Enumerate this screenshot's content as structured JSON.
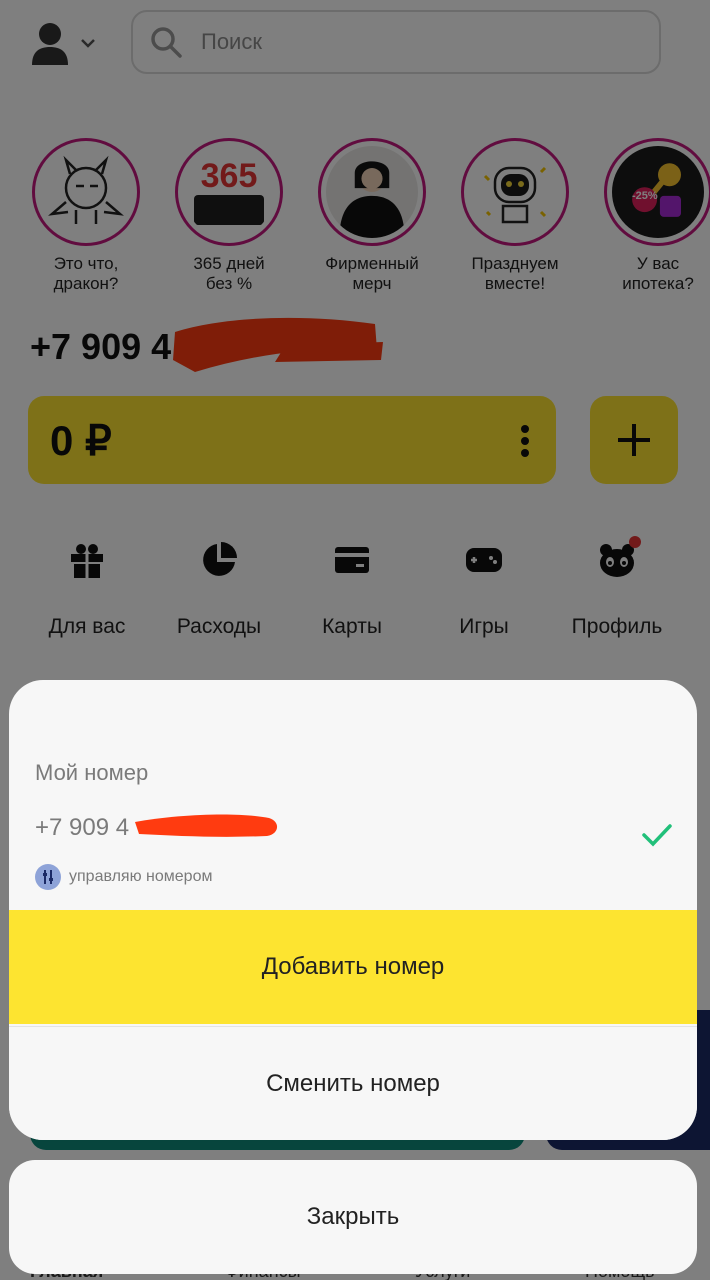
{
  "header": {
    "search_placeholder": "Поиск",
    "icons": {
      "avatar": "person-icon",
      "dropdown": "chevron-down-icon",
      "search": "search-icon"
    }
  },
  "stories": [
    {
      "caption_line1": "Это что,",
      "caption_line2": "дракон?",
      "image": "dragon-sticker"
    },
    {
      "caption_line1": "365 дней",
      "caption_line2": "без %",
      "image": "365-card",
      "image_text": "365"
    },
    {
      "caption_line1": "Фирменный",
      "caption_line2": "мерч",
      "image": "person-in-hoodie"
    },
    {
      "caption_line1": "Празднуем",
      "caption_line2": "вместе!",
      "image": "robot-mascot"
    },
    {
      "caption_line1": "У вас",
      "caption_line2": "ипотека?",
      "image": "keys",
      "image_text": "-25%"
    }
  ],
  "account": {
    "phone_visible": "+7 909 4",
    "balance": "0 ₽"
  },
  "quick_actions": [
    {
      "label": "Для вас",
      "icon": "gift-icon"
    },
    {
      "label": "Расходы",
      "icon": "pie-chart-icon"
    },
    {
      "label": "Карты",
      "icon": "card-icon"
    },
    {
      "label": "Игры",
      "icon": "gamepad-icon"
    },
    {
      "label": "Профиль",
      "icon": "panda-icon"
    }
  ],
  "tabbar": {
    "tabs": [
      "Главная",
      "Финансы",
      "Услуги",
      "Помощь"
    ]
  },
  "sheet": {
    "title": "Мой номер",
    "number_visible": "+7 909 4",
    "manage_label": "управляю номером",
    "add_button": "Добавить номер",
    "change_button": "Сменить номер",
    "close_button": "Закрыть"
  },
  "colors": {
    "accent_yellow": "#fde330",
    "story_ring": "#c2187f",
    "check_green": "#21c07a",
    "redaction": "#ff3b10"
  }
}
